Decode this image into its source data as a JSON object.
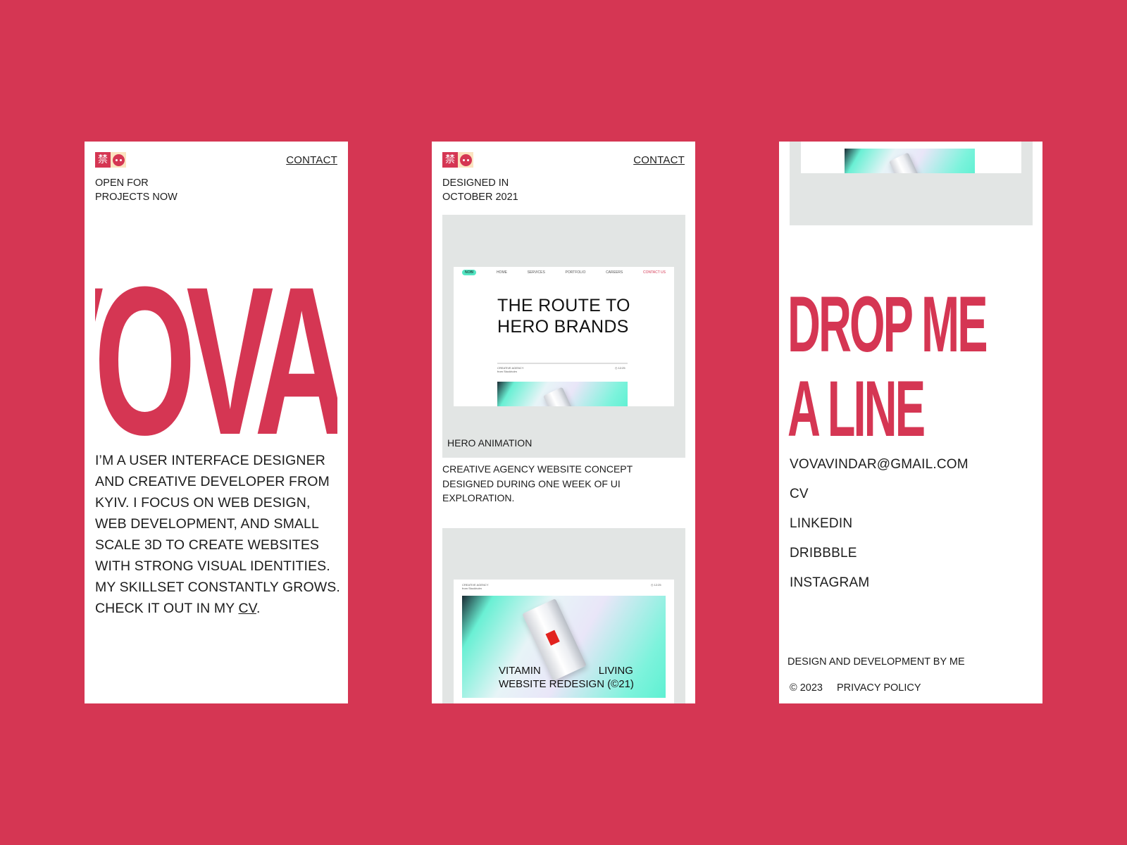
{
  "colors": {
    "brand": "#d53653",
    "panel_gray": "#e2e5e4",
    "text": "#1d1d1d",
    "mint": "#54e6c3"
  },
  "logo": {
    "glyph": "禁",
    "icon_a": "kanji-logo-icon",
    "icon_b": "face-logo-icon"
  },
  "screen1": {
    "contact_label": "CONTACT",
    "status_line1": "OPEN FOR",
    "status_line2": "PROJECTS NOW",
    "big_name": "VOVA",
    "bio_text": "I’M A USER INTERFACE DESIGNER AND CREATIVE DEVELOPER FROM KYIV. I FOCUS ON WEB DESIGN, WEB DEVELOPMENT, AND SMALL SCALE 3D TO CREATE WEBSITES WITH STRONG VISUAL IDENTITIES. MY SKILLSET CONSTANTLY GROWS. CHECK IT OUT IN MY ",
    "bio_link": "CV",
    "bio_end": "."
  },
  "screen2": {
    "contact_label": "CONTACT",
    "designed_line1": "DESIGNED IN",
    "designed_line2": "OCTOBER 2021",
    "mock_nav": {
      "pill": "NOBI",
      "items": [
        "HOME",
        "SERVICES",
        "PORTFOLIO",
        "CAREERS"
      ],
      "cta": "CONTACT US"
    },
    "mock_title_line1": "THE ROUTE TO",
    "mock_title_line2": "HERO BRANDS",
    "mock_meta_left_line1": "CREATIVE AGENCY",
    "mock_meta_left_line2": "from Stockholm",
    "mock_meta_right": "◷ 12:25",
    "project1_caption": "HERO ANIMATION",
    "project1_desc": "CREATIVE AGENCY WEBSITE CONCEPT DESIGNED DURING ONE WEEK OF UI EXPLORATION.",
    "project2_meta_left_line1": "CREATIVE AGENCY",
    "project2_meta_left_line2": "from Stockholm",
    "project2_meta_right": "◷ 12:25",
    "project2_title_line1_a": "VITAMIN",
    "project2_title_line1_b": "LIVING",
    "project2_title_line2": "WEBSITE REDESIGN (©21)"
  },
  "screen3": {
    "headline_line1": "DROP ME",
    "headline_line2": "A LINE",
    "links": [
      "VOVAVINDAR@GMAIL.COM",
      "CV",
      "LINKEDIN",
      "DRIBBBLE",
      "INSTAGRAM"
    ],
    "credit": "DESIGN AND DEVELOPMENT BY ME",
    "copyright": "© 2023",
    "privacy": "PRIVACY POLICY"
  }
}
